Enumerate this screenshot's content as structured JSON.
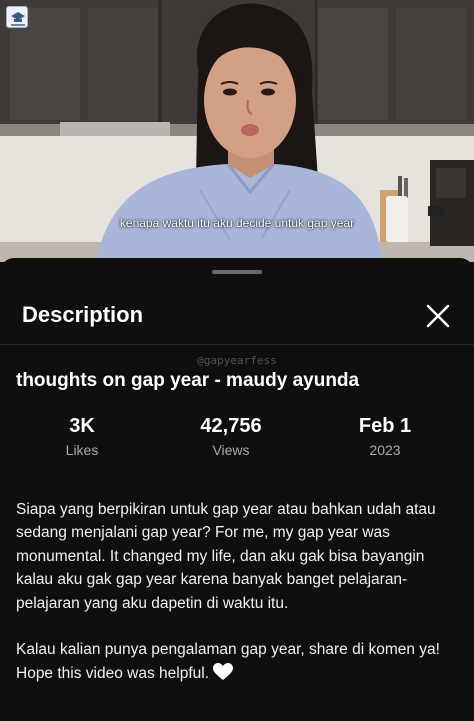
{
  "video": {
    "caption": "kenapa waktu itu aku decide untuk gap year"
  },
  "sheet": {
    "title": "Description",
    "close_icon": "close-icon"
  },
  "watermark_handle": "@gapyearfess",
  "video_title": "thoughts on gap year - maudy ayunda",
  "stats": {
    "likes_value": "3K",
    "likes_label": "Likes",
    "views_value": "42,756",
    "views_label": "Views",
    "date_value": "Feb 1",
    "date_year": "2023"
  },
  "description": {
    "paragraph_1": "Siapa yang berpikiran untuk gap year atau bahkan udah atau sedang menjalani gap year? For me, my gap year was monumental. It changed my life, dan aku gak bisa bayangin kalau aku gak gap year karena banyak banget pelajaran-pelajaran yang aku dapetin di waktu itu.",
    "paragraph_2": "Kalau kalian punya pengalaman gap year, share di komen ya! Hope this video was helpful.",
    "emoji": "white-heart-icon"
  },
  "colors": {
    "background": "#0f0f0f",
    "text_primary": "#f1f1f1",
    "text_secondary": "#aaaaaa"
  }
}
